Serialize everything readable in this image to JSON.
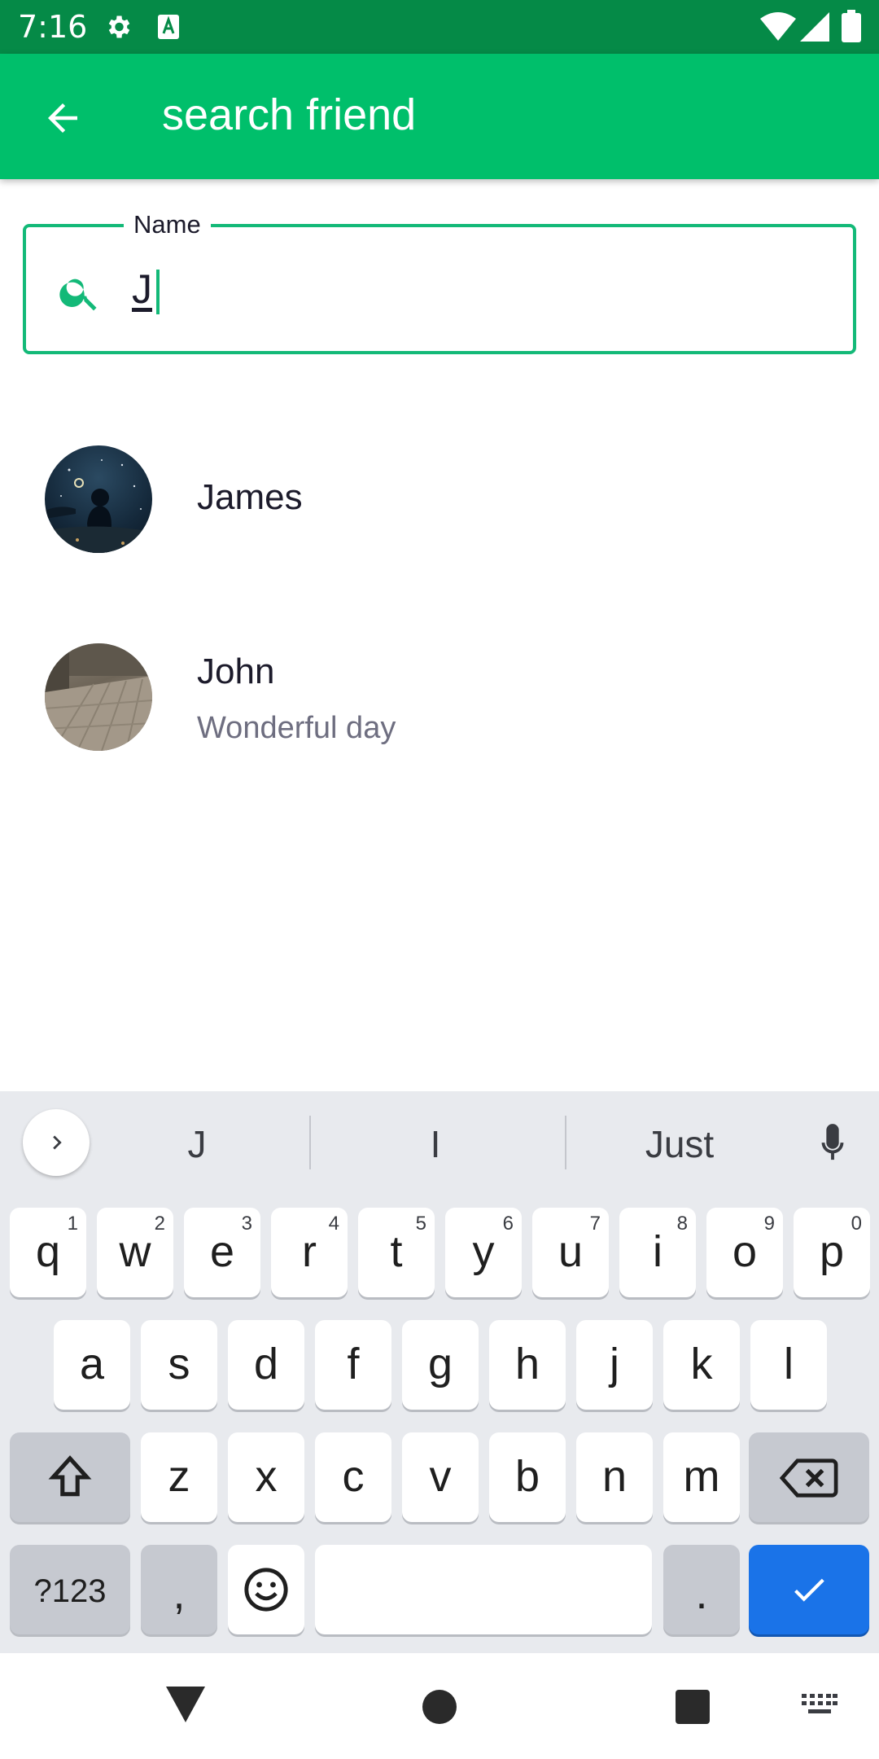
{
  "status_bar": {
    "time": "7:16"
  },
  "app_bar": {
    "title": "search friend"
  },
  "search": {
    "label": "Name",
    "value": "J"
  },
  "friends": [
    {
      "name": "James",
      "status": ""
    },
    {
      "name": "John",
      "status": "Wonderful day"
    }
  ],
  "keyboard": {
    "suggestions": [
      "J",
      "I",
      "Just"
    ],
    "row1": [
      {
        "ch": "q",
        "num": "1"
      },
      {
        "ch": "w",
        "num": "2"
      },
      {
        "ch": "e",
        "num": "3"
      },
      {
        "ch": "r",
        "num": "4"
      },
      {
        "ch": "t",
        "num": "5"
      },
      {
        "ch": "y",
        "num": "6"
      },
      {
        "ch": "u",
        "num": "7"
      },
      {
        "ch": "i",
        "num": "8"
      },
      {
        "ch": "o",
        "num": "9"
      },
      {
        "ch": "p",
        "num": "0"
      }
    ],
    "row2": [
      "a",
      "s",
      "d",
      "f",
      "g",
      "h",
      "j",
      "k",
      "l"
    ],
    "row3": [
      "z",
      "x",
      "c",
      "v",
      "b",
      "n",
      "m"
    ],
    "symbols_label": "?123",
    "comma_label": ",",
    "period_label": "."
  },
  "colors": {
    "primary": "#00bf6b",
    "status_bar": "#058a47",
    "accent_key": "#1a73e8"
  }
}
